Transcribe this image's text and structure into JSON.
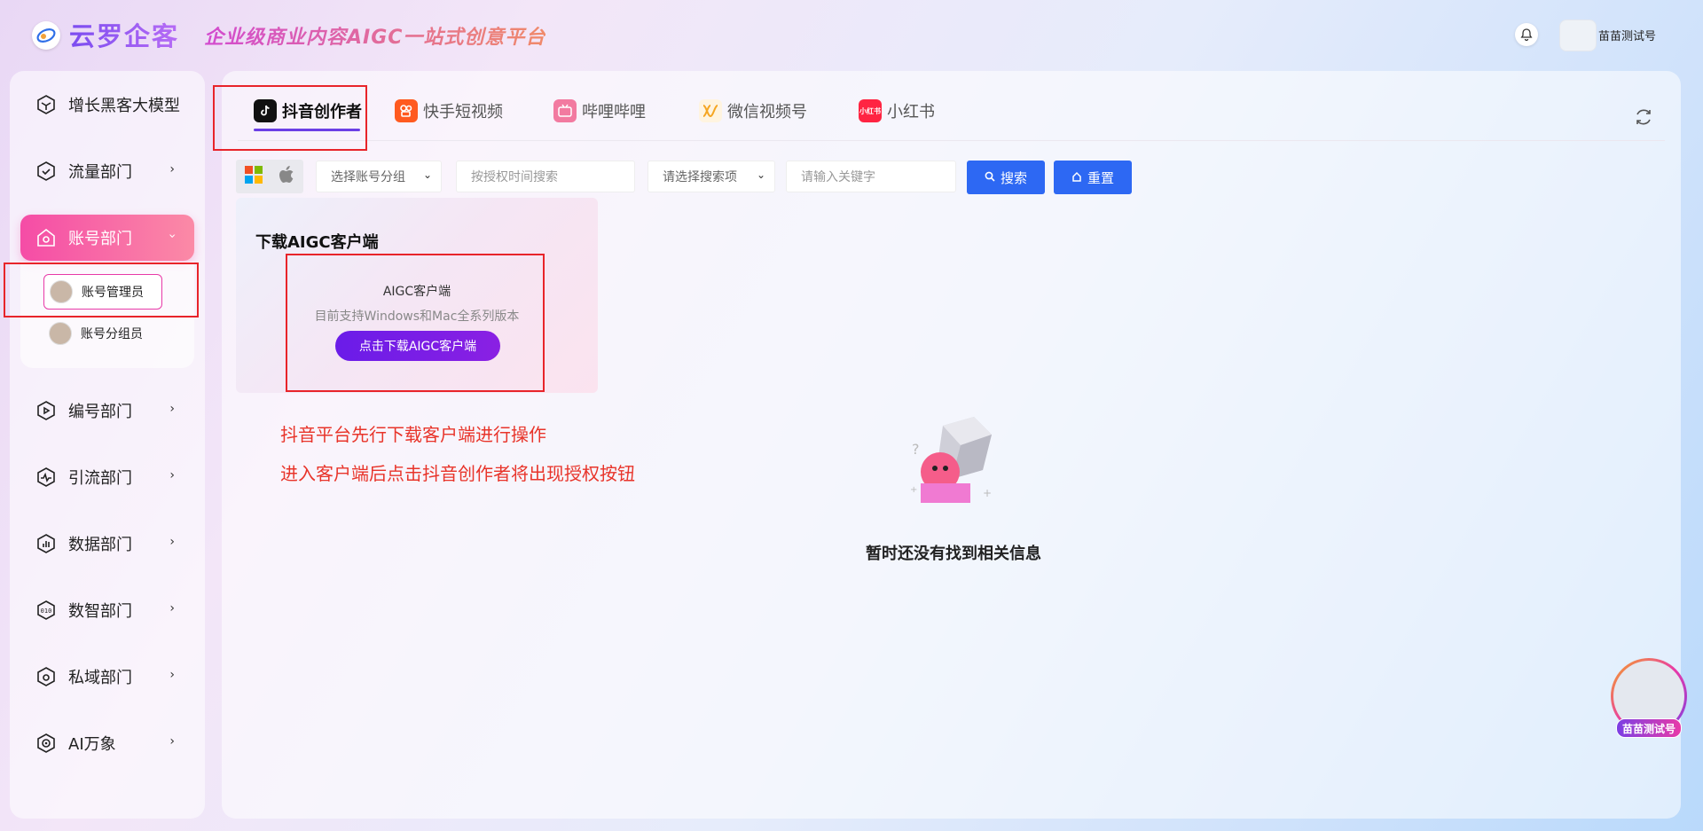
{
  "header": {
    "app_title": "云罗企客",
    "slogan": "企业级商业内容AIGC一站式创意平台",
    "user_name": "苗苗测试号"
  },
  "sidebar": {
    "items": [
      {
        "label": "增长黑客大模型",
        "icon": "cube-icon"
      },
      {
        "label": "流量部门",
        "icon": "shield-check-icon"
      },
      {
        "label": "账号部门",
        "icon": "home-icon",
        "active": true
      },
      {
        "label": "编号部门",
        "icon": "play-icon"
      },
      {
        "label": "引流部门",
        "icon": "pulse-icon"
      },
      {
        "label": "数据部门",
        "icon": "bar-chart-icon"
      },
      {
        "label": "数智部门",
        "icon": "binary-icon"
      },
      {
        "label": "私域部门",
        "icon": "lock-icon"
      },
      {
        "label": "AI万象",
        "icon": "ai-icon"
      }
    ],
    "sub_items": [
      {
        "label": "账号管理员",
        "selected": true
      },
      {
        "label": "账号分组员"
      }
    ]
  },
  "tabs": [
    {
      "label": "抖音创作者",
      "icon": "tiktok-icon",
      "active": true
    },
    {
      "label": "快手短视频",
      "icon": "kuaishou-icon"
    },
    {
      "label": "哔哩哔哩",
      "icon": "bilibili-icon"
    },
    {
      "label": "微信视频号",
      "icon": "wechat-channels-icon"
    },
    {
      "label": "小红书",
      "icon": "xiaohongshu-icon",
      "icon_text": "小红书"
    }
  ],
  "filters": {
    "account_group_select": "选择账号分组",
    "auth_time_placeholder": "按授权时间搜索",
    "search_item_select": "请选择搜索项",
    "keyword_placeholder": "请输入关键字",
    "search_button": "搜索",
    "reset_button": "重置"
  },
  "download_card": {
    "title": "下载AIGC客户端",
    "client_name": "AIGC客户端",
    "support_text": "目前支持Windows和Mac全系列版本",
    "download_button": "点击下载AIGC客户端"
  },
  "annotations": [
    "抖音平台先行下载客户端进行操作",
    "进入客户端后点击抖音创作者将出现授权按钮"
  ],
  "empty_state": {
    "message": "暂时还没有找到相关信息"
  },
  "floating": {
    "badge": "苗苗测试号"
  },
  "colors": {
    "accent_purple": "#6b3fe5",
    "active_pink": "#f54ca6",
    "button_blue": "#2d68f3",
    "annotation_red": "#e8242a"
  }
}
